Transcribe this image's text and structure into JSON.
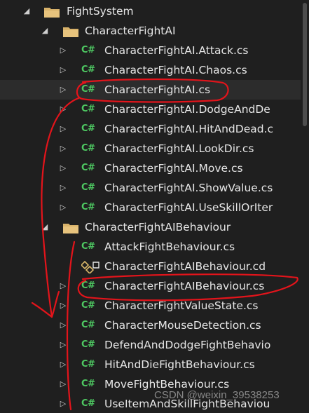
{
  "tree": {
    "root": {
      "label": "FightSystem",
      "expanded": true,
      "icon": "folder-icon"
    },
    "folder1": {
      "label": "CharacterFightAI",
      "expanded": true,
      "icon": "folder-icon",
      "files": [
        "CharacterFightAI.Attack.cs",
        "CharacterFightAI.Chaos.cs",
        "CharacterFightAI.cs",
        "CharacterFightAI.DodgeAndDe",
        "CharacterFightAI.HitAndDead.c",
        "CharacterFightAI.LookDir.cs",
        "CharacterFightAI.Move.cs",
        "CharacterFightAI.ShowValue.cs",
        "CharacterFightAI.UseSkillOrIter"
      ]
    },
    "folder2": {
      "label": "CharacterFightAIBehaviour",
      "expanded": true,
      "icon": "folder-icon",
      "files": [
        "AttackFightBehaviour.cs",
        "CharacterFightAIBehaviour.cd",
        "CharacterFightAIBehaviour.cs",
        "CharacterFightValueState.cs",
        "CharacterMouseDetection.cs",
        "DefendAndDodgeFightBehavio",
        "HitAndDieFightBehaviour.cs",
        "MoveFightBehaviour.cs",
        "UseItemAndSkillFightBehaviou"
      ]
    }
  },
  "cs_icon_text": "C#",
  "watermark": "CSDN @weixin_39538253",
  "colors": {
    "background": "#1f1f1f",
    "text": "#e6e6e6",
    "cs_icon": "#4ec962",
    "folder": "#d8b26a",
    "annotation": "#e3141b"
  }
}
